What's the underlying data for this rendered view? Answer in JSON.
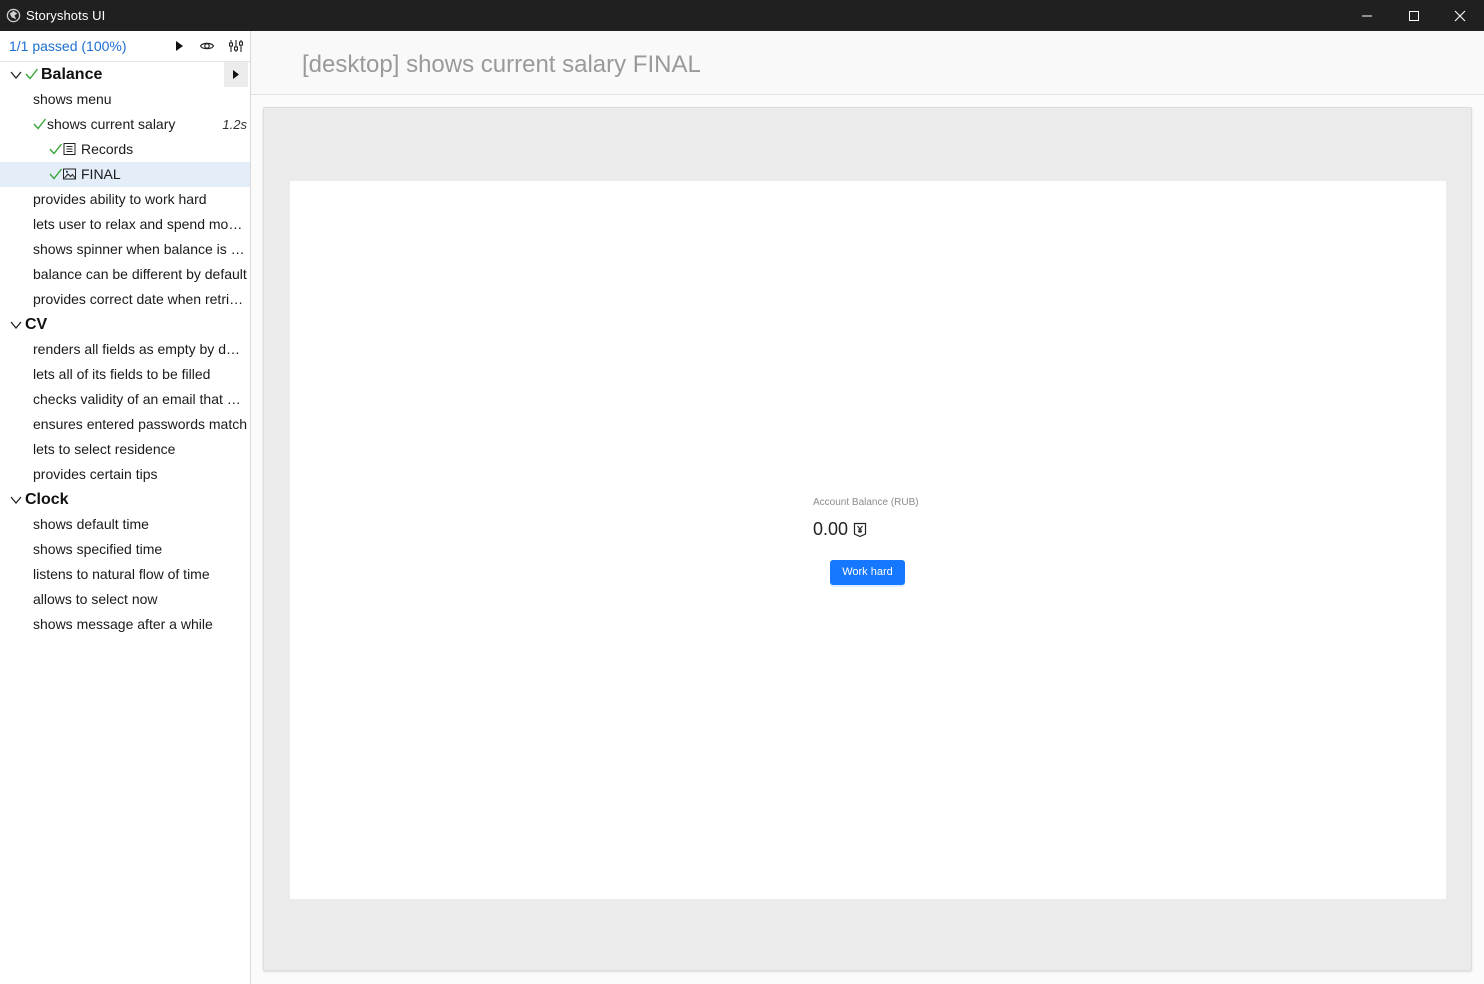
{
  "window": {
    "title": "Storyshots UI"
  },
  "sidebar": {
    "summary": "1/1 passed (100%)",
    "header_icons": [
      "play-icon",
      "eye-icon",
      "settings-sliders-icon"
    ],
    "groups": [
      {
        "label": "Balance",
        "passed": true,
        "stories": [
          {
            "label": "shows menu"
          },
          {
            "label": "shows current salary",
            "passed": true,
            "duration": "1.2s",
            "children": [
              {
                "label": "Records",
                "icon": "records-icon",
                "passed": true
              },
              {
                "label": "FINAL",
                "icon": "image-icon",
                "passed": true,
                "selected": true
              }
            ]
          },
          {
            "label": "provides ability to work hard"
          },
          {
            "label": "lets user to relax and spend mon..."
          },
          {
            "label": "shows spinner when balance is n..."
          },
          {
            "label": "balance can be different by default"
          },
          {
            "label": "provides correct date when retrie..."
          }
        ]
      },
      {
        "label": "CV",
        "stories": [
          {
            "label": "renders all fields as empty by def..."
          },
          {
            "label": "lets all of its fields to be filled"
          },
          {
            "label": "checks validity of an email that w..."
          },
          {
            "label": "ensures entered passwords match"
          },
          {
            "label": "lets to select residence"
          },
          {
            "label": "provides certain tips"
          }
        ]
      },
      {
        "label": "Clock",
        "stories": [
          {
            "label": "shows default time"
          },
          {
            "label": "shows specified time"
          },
          {
            "label": "listens to natural flow of time"
          },
          {
            "label": "allows to select now"
          },
          {
            "label": "shows message after a while"
          }
        ]
      }
    ]
  },
  "main": {
    "title": "[desktop] shows current salary FINAL",
    "preview": {
      "balance_label": "Account Balance (RUB)",
      "balance_value": "0.00",
      "button_label": "Work hard"
    }
  },
  "colors": {
    "accent": "#1c6fd1",
    "check": "#3aa53a",
    "button": "#1677ff",
    "titlebar": "#202020"
  }
}
